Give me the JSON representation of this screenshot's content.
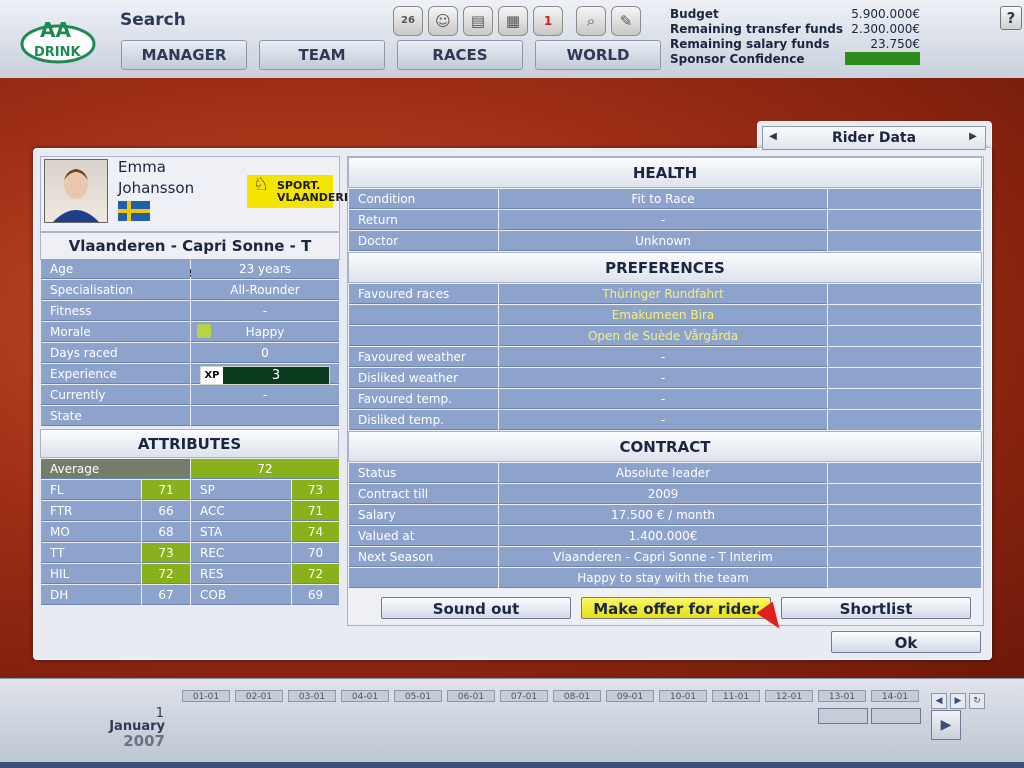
{
  "header": {
    "title": "Search",
    "nav_tabs": [
      "MANAGER",
      "TEAM",
      "RACES",
      "WORLD"
    ],
    "budget": [
      {
        "label": "Budget",
        "value": "5.900.000€"
      },
      {
        "label": "Remaining transfer funds",
        "value": "2.300.000€"
      },
      {
        "label": "Remaining salary funds",
        "value": "23.750€"
      },
      {
        "label": "Sponsor Confidence",
        "value": ""
      }
    ],
    "help": "?",
    "calendar_day": "26",
    "mail_count": "1"
  },
  "panel": {
    "title": "Rider Data"
  },
  "rider": {
    "first_name": "Emma",
    "last_name": "Johansson",
    "team": "Vlaanderen - Capri Sonne - T Interim",
    "sponsor_logo": "SPORT. VLAANDEREN",
    "info": [
      {
        "label": "Age",
        "value": "23 years"
      },
      {
        "label": "Specialisation",
        "value": "All-Rounder"
      },
      {
        "label": "Fitness",
        "value": "-"
      },
      {
        "label": "Morale",
        "value": "Happy"
      },
      {
        "label": "Days raced",
        "value": "0"
      },
      {
        "label": "Experience",
        "value": "3"
      },
      {
        "label": "Currently",
        "value": "-"
      },
      {
        "label": "State",
        "value": ""
      }
    ],
    "xp_label": "XP"
  },
  "attributes": {
    "title": "ATTRIBUTES",
    "average_label": "Average",
    "average_value": "72",
    "rows": [
      {
        "a": "FL",
        "av": "71",
        "b": "SP",
        "bv": "73",
        "ag": true,
        "bg": true
      },
      {
        "a": "FTR",
        "av": "66",
        "b": "ACC",
        "bv": "71",
        "ag": false,
        "bg": true
      },
      {
        "a": "MO",
        "av": "68",
        "b": "STA",
        "bv": "74",
        "ag": false,
        "bg": true
      },
      {
        "a": "TT",
        "av": "73",
        "b": "REC",
        "bv": "70",
        "ag": true,
        "bg": false
      },
      {
        "a": "HIL",
        "av": "72",
        "b": "RES",
        "bv": "72",
        "ag": true,
        "bg": true
      },
      {
        "a": "DH",
        "av": "67",
        "b": "COB",
        "bv": "69",
        "ag": false,
        "bg": false
      }
    ]
  },
  "health": {
    "title": "HEALTH",
    "rows": [
      {
        "label": "Condition",
        "value": "Fit to Race"
      },
      {
        "label": "Return",
        "value": "-"
      },
      {
        "label": "Doctor",
        "value": "Unknown"
      }
    ]
  },
  "preferences": {
    "title": "PREFERENCES",
    "rows": [
      {
        "label": "Favoured races",
        "value": "Thüringer Rundfahrt",
        "highlight": true
      },
      {
        "label": "",
        "value": "Emakumeen Bira",
        "highlight": true
      },
      {
        "label": "",
        "value": "Open de Suède Vårgårda",
        "highlight": true
      },
      {
        "label": "Favoured weather",
        "value": "-",
        "highlight": false
      },
      {
        "label": "Disliked weather",
        "value": "-",
        "highlight": false
      },
      {
        "label": "Favoured temp.",
        "value": "-",
        "highlight": false
      },
      {
        "label": "Disliked temp.",
        "value": "-",
        "highlight": false
      }
    ]
  },
  "contract": {
    "title": "CONTRACT",
    "rows": [
      {
        "label": "Status",
        "value": "Absolute leader"
      },
      {
        "label": "Contract till",
        "value": "2009"
      },
      {
        "label": "Salary",
        "value": "17.500 € / month"
      },
      {
        "label": "Valued at",
        "value": "1.400.000€"
      },
      {
        "label": "Next Season",
        "value": "Vlaanderen - Capri Sonne - T Interim"
      },
      {
        "label": "",
        "value": "Happy to stay with the team"
      }
    ]
  },
  "actions": {
    "sound_out": "Sound out",
    "make_offer": "Make offer for rider",
    "shortlist": "Shortlist",
    "ok": "Ok"
  },
  "timeline": {
    "dates": [
      "01-01",
      "02-01",
      "03-01",
      "04-01",
      "05-01",
      "06-01",
      "07-01",
      "08-01",
      "09-01",
      "10-01",
      "11-01",
      "12-01",
      "13-01",
      "14-01"
    ],
    "day": "1",
    "month": "January",
    "year": "2007"
  },
  "colors": {
    "accent": "#8ea3cc",
    "highlight_green": "#8ab01b",
    "offer_button": "#f0ea1e",
    "sponsor_confidence_bar": "#2d8c1c"
  }
}
